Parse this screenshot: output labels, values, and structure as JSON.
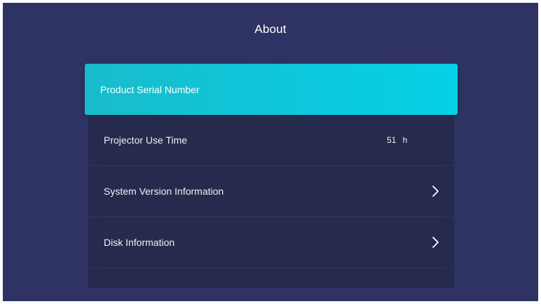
{
  "header": {
    "title": "About"
  },
  "menu": {
    "selected": {
      "label": "Product Serial Number"
    },
    "items": [
      {
        "label": "Projector Use Time",
        "value": "51 h"
      },
      {
        "label": "System Version Information",
        "icon": "chevron-right-icon"
      },
      {
        "label": "Disk Information",
        "icon": "chevron-right-icon"
      }
    ]
  },
  "colors": {
    "background": "#2f3363",
    "item_background": "#262a4c",
    "highlight": "#0ec7db",
    "text": "#ffffff"
  }
}
